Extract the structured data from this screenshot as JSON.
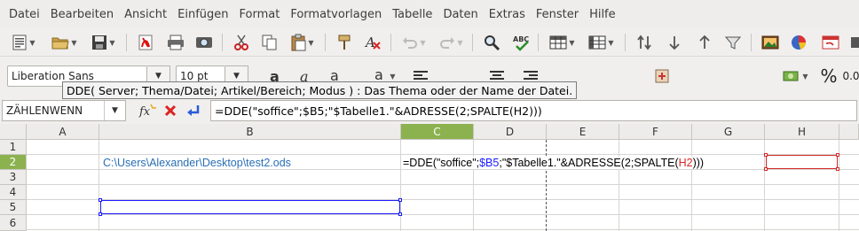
{
  "menu": [
    "Datei",
    "Bearbeiten",
    "Ansicht",
    "Einfügen",
    "Format",
    "Formatvorlagen",
    "Tabelle",
    "Daten",
    "Extras",
    "Fenster",
    "Hilfe"
  ],
  "toolbar": {
    "icons": [
      "new-document",
      "open",
      "save",
      "export-pdf",
      "print",
      "print-preview",
      "cut",
      "copy",
      "paste",
      "clone-formatting",
      "clear-formatting",
      "undo",
      "redo",
      "find-replace",
      "spelling",
      "row",
      "column",
      "sort",
      "sort-ascending",
      "sort-descending",
      "autofilter",
      "insert-image",
      "insert-chart",
      "pivot-table"
    ],
    "font_name": "Liberation Sans",
    "font_size": "10 pt",
    "percent_label": "%",
    "decimal_label": "0.0"
  },
  "tooltip": "DDE( Server; Thema/Datei; Artikel/Bereich; Modus ) : Das Thema oder der Name der Datei.",
  "formula_bar": {
    "name_box": "ZÄHLENWENN",
    "formula": "=DDE(\"soffice\";$B5;\"$Tabelle1.\"&ADRESSE(2;SPALTE(H2)))"
  },
  "grid": {
    "columns": [
      "A",
      "B",
      "C",
      "D",
      "E",
      "F",
      "G",
      "H"
    ],
    "active_column": "C",
    "rows": [
      "1",
      "2",
      "3",
      "4",
      "5",
      "6"
    ],
    "active_row": "2",
    "cells": {
      "B2": "C:\\Users\\Alexander\\Desktop\\test2.ods",
      "C2_part1": "=DDE(\"soffice\";",
      "C2_ref1": "$B5",
      "C2_part2": ";\"$Tabelle1.\"&ADRESSE(2;SPALTE(",
      "C2_ref2": "H2",
      "C2_part3": ")))"
    }
  },
  "colors": {
    "accent_green": "#8cb24f",
    "ref_blue": "#1a1aff",
    "ref_red": "#d62828",
    "link_text": "#2a6fb5"
  }
}
